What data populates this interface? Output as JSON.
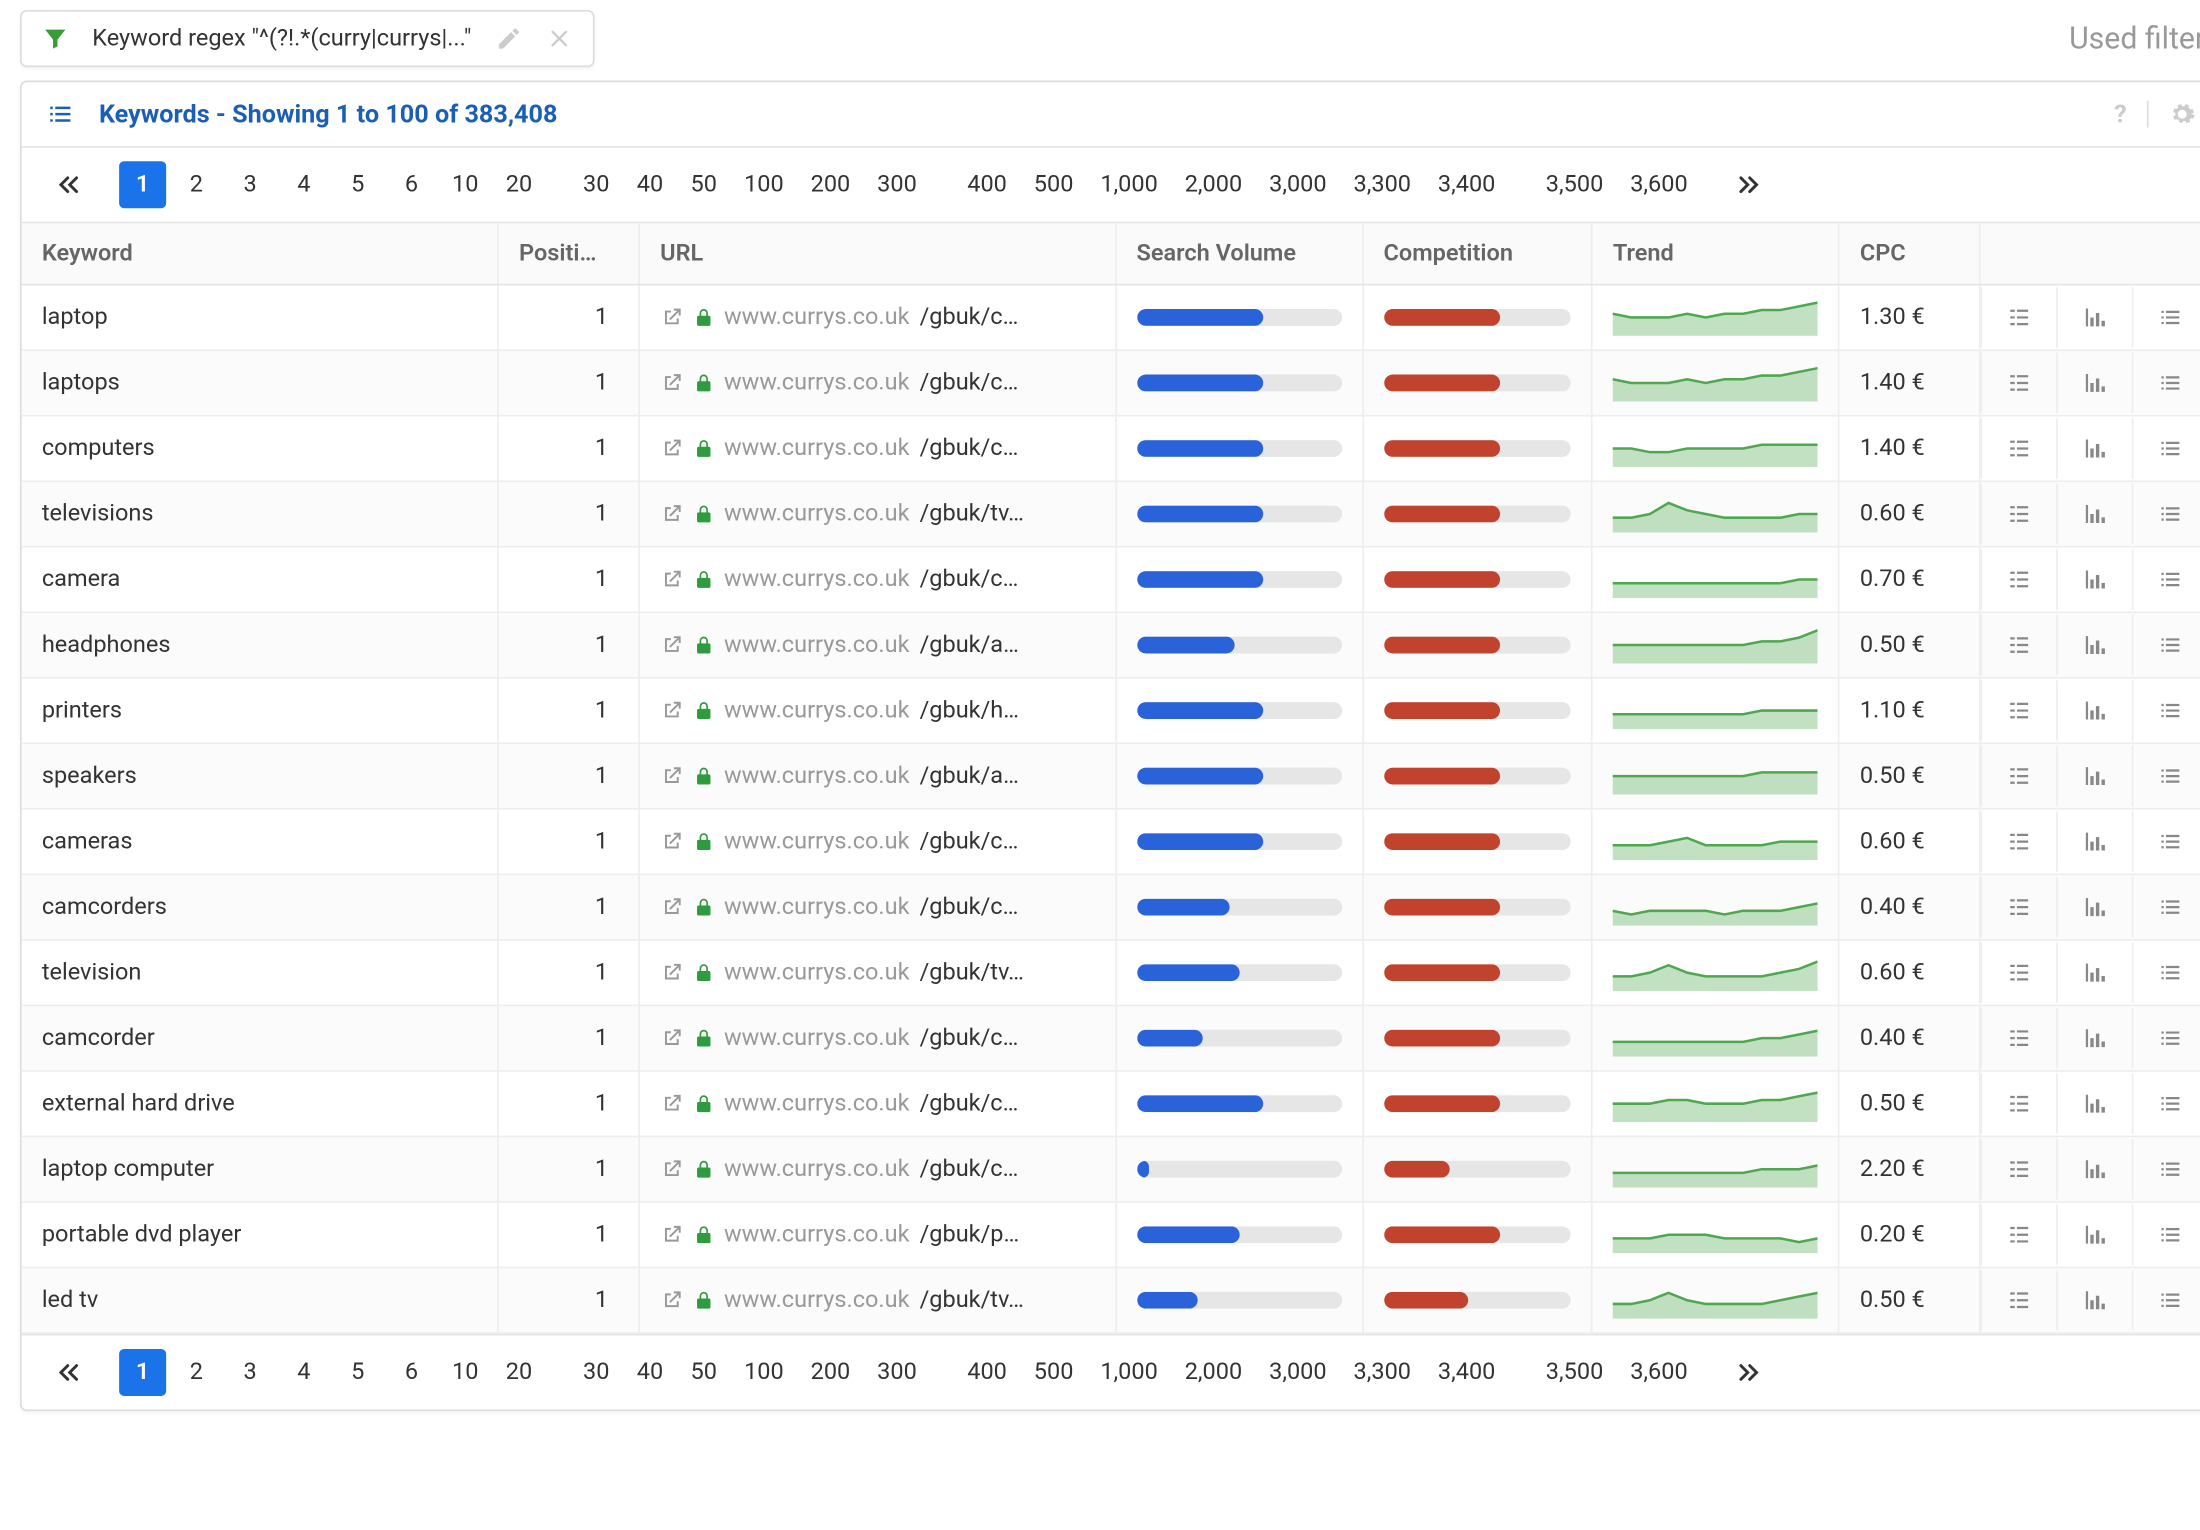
{
  "filter": {
    "label": "Keyword regex \"^(?!.*(curry|currys|...\"",
    "used_filters_label": "Used filters"
  },
  "panel": {
    "title": "Keywords - Showing 1 to 100 of 383,408"
  },
  "pagination": {
    "active": "1",
    "groups": [
      [
        "1",
        "2",
        "3",
        "4",
        "5",
        "6",
        "10",
        "20"
      ],
      [
        "30",
        "40",
        "50",
        "100",
        "200",
        "300"
      ],
      [
        "400",
        "500",
        "1,000",
        "2,000",
        "3,000",
        "3,300",
        "3,400"
      ],
      [
        "3,500",
        "3,600"
      ]
    ]
  },
  "columns": {
    "keyword": "Keyword",
    "position": "Positi…",
    "url": "URL",
    "search_volume": "Search Volume",
    "competition": "Competition",
    "trend": "Trend",
    "cpc": "CPC"
  },
  "url_domain": "www.currys.co.uk",
  "rows": [
    {
      "keyword": "laptop",
      "position": "1",
      "url_path": "/gbuk/c…",
      "sv": 62,
      "comp": 62,
      "trend": [
        6,
        5,
        5,
        5,
        6,
        5,
        6,
        6,
        7,
        7,
        8,
        9
      ],
      "cpc": "1.30 €"
    },
    {
      "keyword": "laptops",
      "position": "1",
      "url_path": "/gbuk/c…",
      "sv": 62,
      "comp": 62,
      "trend": [
        6,
        5,
        5,
        5,
        6,
        5,
        6,
        6,
        7,
        7,
        8,
        9
      ],
      "cpc": "1.40 €"
    },
    {
      "keyword": "computers",
      "position": "1",
      "url_path": "/gbuk/c…",
      "sv": 62,
      "comp": 62,
      "trend": [
        5,
        5,
        4,
        4,
        5,
        5,
        5,
        5,
        6,
        6,
        6,
        6
      ],
      "cpc": "1.40 €"
    },
    {
      "keyword": "televisions",
      "position": "1",
      "url_path": "/gbuk/tv…",
      "sv": 62,
      "comp": 62,
      "trend": [
        4,
        4,
        5,
        8,
        6,
        5,
        4,
        4,
        4,
        4,
        5,
        5
      ],
      "cpc": "0.60 €"
    },
    {
      "keyword": "camera",
      "position": "1",
      "url_path": "/gbuk/c…",
      "sv": 62,
      "comp": 62,
      "trend": [
        4,
        4,
        4,
        4,
        4,
        4,
        4,
        4,
        4,
        4,
        5,
        5
      ],
      "cpc": "0.70 €"
    },
    {
      "keyword": "headphones",
      "position": "1",
      "url_path": "/gbuk/a…",
      "sv": 48,
      "comp": 62,
      "trend": [
        5,
        5,
        5,
        5,
        5,
        5,
        5,
        5,
        6,
        6,
        7,
        9
      ],
      "cpc": "0.50 €"
    },
    {
      "keyword": "printers",
      "position": "1",
      "url_path": "/gbuk/h…",
      "sv": 62,
      "comp": 62,
      "trend": [
        4,
        4,
        4,
        4,
        4,
        4,
        4,
        4,
        5,
        5,
        5,
        5
      ],
      "cpc": "1.10 €"
    },
    {
      "keyword": "speakers",
      "position": "1",
      "url_path": "/gbuk/a…",
      "sv": 62,
      "comp": 62,
      "trend": [
        5,
        5,
        5,
        5,
        5,
        5,
        5,
        5,
        6,
        6,
        6,
        6
      ],
      "cpc": "0.50 €"
    },
    {
      "keyword": "cameras",
      "position": "1",
      "url_path": "/gbuk/c…",
      "sv": 62,
      "comp": 62,
      "trend": [
        4,
        4,
        4,
        5,
        6,
        4,
        4,
        4,
        4,
        5,
        5,
        5
      ],
      "cpc": "0.60 €"
    },
    {
      "keyword": "camcorders",
      "position": "1",
      "url_path": "/gbuk/c…",
      "sv": 45,
      "comp": 62,
      "trend": [
        4,
        3,
        4,
        4,
        4,
        4,
        3,
        4,
        4,
        4,
        5,
        6
      ],
      "cpc": "0.40 €"
    },
    {
      "keyword": "television",
      "position": "1",
      "url_path": "/gbuk/tv…",
      "sv": 50,
      "comp": 62,
      "trend": [
        4,
        4,
        5,
        7,
        5,
        4,
        4,
        4,
        4,
        5,
        6,
        8
      ],
      "cpc": "0.60 €"
    },
    {
      "keyword": "camcorder",
      "position": "1",
      "url_path": "/gbuk/c…",
      "sv": 32,
      "comp": 62,
      "trend": [
        4,
        4,
        4,
        4,
        4,
        4,
        4,
        4,
        5,
        5,
        6,
        7
      ],
      "cpc": "0.40 €"
    },
    {
      "keyword": "external hard drive",
      "position": "1",
      "url_path": "/gbuk/c…",
      "sv": 62,
      "comp": 62,
      "trend": [
        5,
        5,
        5,
        6,
        6,
        5,
        5,
        5,
        6,
        6,
        7,
        8
      ],
      "cpc": "0.50 €"
    },
    {
      "keyword": "laptop computer",
      "position": "1",
      "url_path": "/gbuk/c…",
      "sv": 6,
      "comp": 35,
      "trend": [
        4,
        4,
        4,
        4,
        4,
        4,
        4,
        4,
        5,
        5,
        5,
        6
      ],
      "cpc": "2.20 €"
    },
    {
      "keyword": "portable dvd player",
      "position": "1",
      "url_path": "/gbuk/p…",
      "sv": 50,
      "comp": 62,
      "trend": [
        4,
        4,
        4,
        5,
        5,
        5,
        4,
        4,
        4,
        4,
        3,
        4
      ],
      "cpc": "0.20 €"
    },
    {
      "keyword": "led tv",
      "position": "1",
      "url_path": "/gbuk/tv…",
      "sv": 30,
      "comp": 45,
      "trend": [
        4,
        4,
        5,
        7,
        5,
        4,
        4,
        4,
        4,
        5,
        6,
        7
      ],
      "cpc": "0.50 €"
    }
  ]
}
